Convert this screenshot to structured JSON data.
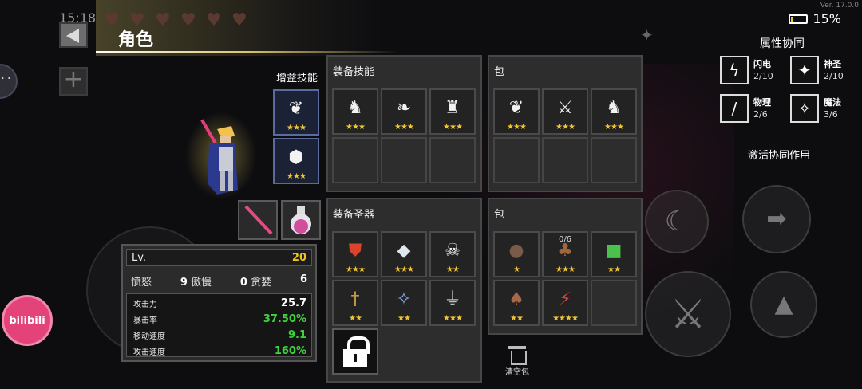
{
  "status": {
    "time": "15:18",
    "battery": "15%",
    "battery_level": 0.15,
    "version": "Ver. 17.0.0"
  },
  "header": {
    "title": "角色",
    "hearts": 6
  },
  "buffs": {
    "label": "增益技能",
    "items": [
      {
        "icon": "skill-icon",
        "stars": "★★★"
      },
      {
        "icon": "shield-icon",
        "stars": "★★★"
      }
    ]
  },
  "equipped": {
    "weapon": "weapon-icon",
    "potion": "potion-icon"
  },
  "stats": {
    "lv_label": "Lv.",
    "lv_value": "20",
    "sins": [
      {
        "label": "愤怒",
        "value": "9"
      },
      {
        "label": "傲慢",
        "value": "0"
      },
      {
        "label": "贪婪",
        "value": "6"
      }
    ],
    "attrs": [
      {
        "label": "攻击力",
        "value": "25.7",
        "color": "#ffffff"
      },
      {
        "label": "暴击率",
        "value": "37.50%",
        "color": "#3fd23f"
      },
      {
        "label": "移动速度",
        "value": "9.1",
        "color": "#3fd23f"
      },
      {
        "label": "攻击速度",
        "value": "160%",
        "color": "#3fd23f"
      }
    ]
  },
  "skills_panel": {
    "title": "装备技能",
    "cells": [
      {
        "stars": "★★★"
      },
      {
        "stars": "★★★"
      },
      {
        "stars": "★★★"
      }
    ]
  },
  "skills_bag": {
    "title": "包",
    "cells": [
      {
        "stars": "★★★"
      },
      {
        "stars": "★★★"
      },
      {
        "stars": "★★★"
      }
    ]
  },
  "relics_panel": {
    "title": "装备圣器",
    "cells": [
      {
        "stars": "★★★"
      },
      {
        "stars": "★★★"
      },
      {
        "stars": "★★"
      },
      {
        "stars": "★★"
      },
      {
        "stars": "★★"
      },
      {
        "stars": "★★★"
      }
    ]
  },
  "relics_bag": {
    "title": "包",
    "cells": [
      {
        "stars": "★",
        "count": ""
      },
      {
        "stars": "★★★",
        "count": "0/6"
      },
      {
        "stars": "★★",
        "count": ""
      },
      {
        "stars": "★★",
        "count": ""
      },
      {
        "stars": "★★★★",
        "count": ""
      }
    ]
  },
  "trash": {
    "label": "清空包"
  },
  "synergy": {
    "title": "属性协同",
    "items": [
      {
        "name": "闪电",
        "count": "2/10",
        "icon": "lightning-icon"
      },
      {
        "name": "神圣",
        "count": "2/10",
        "icon": "holy-icon"
      },
      {
        "name": "物理",
        "count": "2/6",
        "icon": "sword-icon"
      },
      {
        "name": "魔法",
        "count": "3/6",
        "icon": "magic-icon"
      }
    ],
    "activate": "激活协同作用"
  },
  "bili": {
    "label": "bilibili"
  },
  "colors": {
    "accent": "#f0c419",
    "positive": "#3fd23f",
    "panel": "#2d2d2d"
  }
}
